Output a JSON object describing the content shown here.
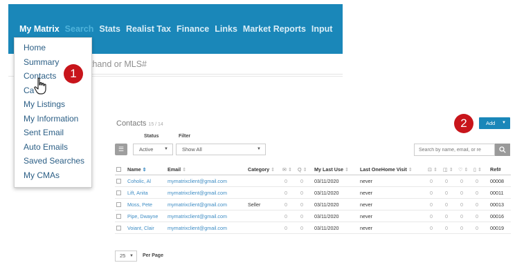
{
  "nav": {
    "items": [
      "My Matrix",
      "Search",
      "Stats",
      "Realist Tax",
      "Finance",
      "Links",
      "Market Reports",
      "Input"
    ]
  },
  "search_strip": {
    "visible_text": "thand or MLS#"
  },
  "dropdown": {
    "items": [
      "Home",
      "Summary",
      "Contacts",
      "Ca",
      "My Listings",
      "My Information",
      "Sent Email",
      "Auto Emails",
      "Saved Searches",
      "My CMAs"
    ]
  },
  "callouts": {
    "one": "1",
    "two": "2"
  },
  "contacts": {
    "title": "Contacts",
    "count": "15 / 14",
    "status_label": "Status",
    "filter_label": "Filter",
    "status_value": "Active",
    "filter_value": "Show All",
    "add_label": "Add",
    "search_placeholder": "Search by name, email, or re",
    "per_page_value": "25",
    "per_page_label": "Per Page"
  },
  "table": {
    "headers": {
      "name": "Name",
      "email": "Email",
      "category": "Category",
      "my_last_use": "My Last Use",
      "last_onehome_visit": "Last OneHome Visit",
      "ref": "Ref#"
    },
    "rows": [
      {
        "name": "Coholic, Al",
        "email": "mymatrixclient@gmail.com",
        "category": "",
        "c1": "0",
        "c2": "0",
        "my_last_use": "03/11/2020",
        "last_visit": "never",
        "c3": "0",
        "c4": "0",
        "c5": "0",
        "c6": "0",
        "ref": "00008"
      },
      {
        "name": "Lift, Anita",
        "email": "mymatrixclient@gmail.com",
        "category": "",
        "c1": "0",
        "c2": "0",
        "my_last_use": "03/11/2020",
        "last_visit": "never",
        "c3": "0",
        "c4": "0",
        "c5": "0",
        "c6": "0",
        "ref": "00011"
      },
      {
        "name": "Moss, Pete",
        "email": "mymatrixclient@gmail.com",
        "category": "Seller",
        "c1": "0",
        "c2": "0",
        "my_last_use": "03/11/2020",
        "last_visit": "never",
        "c3": "0",
        "c4": "0",
        "c5": "0",
        "c6": "0",
        "ref": "00013"
      },
      {
        "name": "Pipe, Dwayne",
        "email": "mymatrixclient@gmail.com",
        "category": "",
        "c1": "0",
        "c2": "0",
        "my_last_use": "03/11/2020",
        "last_visit": "never",
        "c3": "0",
        "c4": "0",
        "c5": "0",
        "c6": "0",
        "ref": "00016"
      },
      {
        "name": "Voiant, Clair",
        "email": "mymatrixclient@gmail.com",
        "category": "",
        "c1": "0",
        "c2": "0",
        "my_last_use": "03/11/2020",
        "last_visit": "never",
        "c3": "0",
        "c4": "0",
        "c5": "0",
        "c6": "0",
        "ref": "00019"
      }
    ]
  },
  "colors": {
    "nav_bg": "#1a87b9",
    "callout": "#c8151b",
    "link": "#3d8cc4",
    "add_button": "#1a87b9"
  }
}
